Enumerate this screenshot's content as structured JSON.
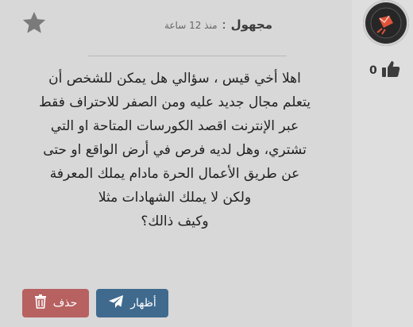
{
  "post": {
    "author": "مجهول",
    "time_separator": ":",
    "time": "منذ 12 ساعة",
    "body_lines": [
      "اهلا أخي قيس ، سؤالي هل يمكن للشخص أن",
      "يتعلم مجال جديد عليه ومن الصفر للاحتراف فقط",
      "عبر الإنترنت اقصد الكورسات المتاحة او التي",
      "تشتري، وهل لديه فرص في أرض الواقع او حتى",
      "عن طريق الأعمال الحرة مادام يملك المعرفة",
      "ولكن لا يملك الشهادات مثلا",
      "وكيف ذالك؟"
    ]
  },
  "vote": {
    "count": "0",
    "icon": "thumbs-up-icon"
  },
  "actions": {
    "show_label": "أظهار",
    "delete_label": "حذف",
    "show_icon": "paper-plane-icon",
    "delete_icon": "trash-icon"
  },
  "colors": {
    "delete_button": "#b86161",
    "show_button": "#3f6a8e",
    "avatar_bg": "#2c2c2c",
    "avatar_accent": "#e0533a"
  }
}
